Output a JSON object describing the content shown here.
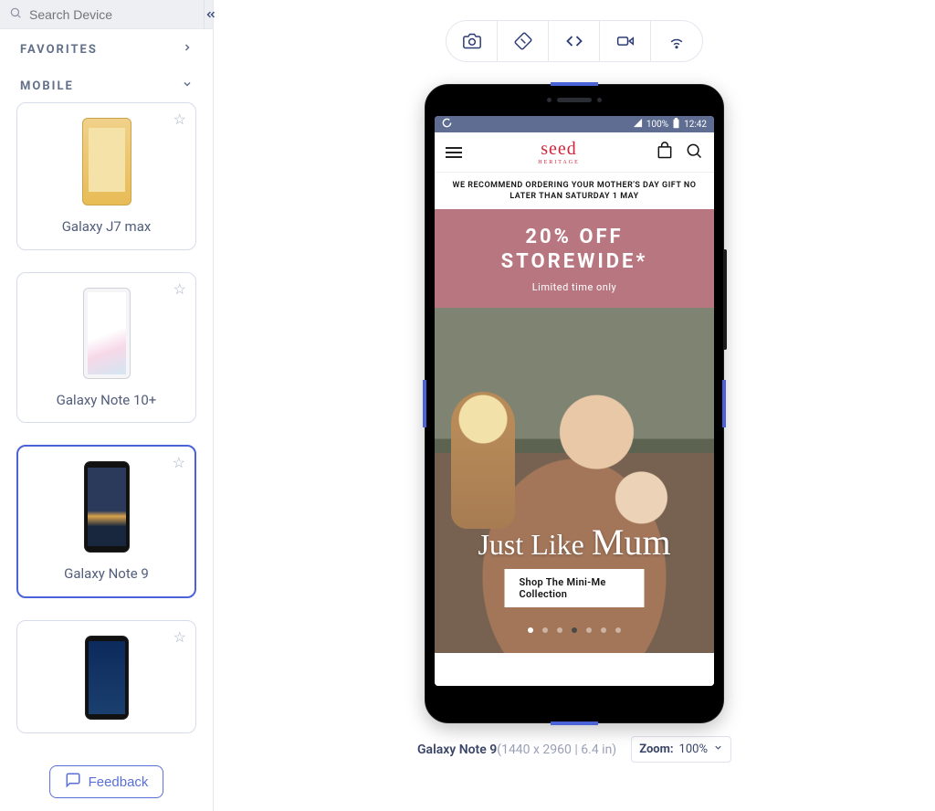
{
  "sidebar": {
    "search_placeholder": "Search Device",
    "sections": {
      "favorites": "FAVORITES",
      "mobile": "MOBILE"
    },
    "devices": [
      {
        "label": "Galaxy J7 max",
        "selected": false,
        "thumb": "thumb-gold"
      },
      {
        "label": "Galaxy Note 10+",
        "selected": false,
        "thumb": "thumb-white"
      },
      {
        "label": "Galaxy Note 9",
        "selected": true,
        "thumb": "thumb-note9"
      },
      {
        "label": "",
        "selected": false,
        "thumb": "thumb-s8"
      }
    ],
    "feedback": "Feedback"
  },
  "toolbar": {
    "items": [
      "camera",
      "rotate",
      "devtools",
      "record",
      "network"
    ]
  },
  "device_preview": {
    "status": {
      "battery": "100%",
      "time": "12:42"
    },
    "site": {
      "brand": "seed",
      "brand_sub": "HERITAGE",
      "notice": "WE RECOMMEND ORDERING YOUR MOTHER'S DAY GIFT NO LATER THAN SATURDAY 1 MAY",
      "promo_line1": "20% OFF",
      "promo_line2": "STOREWIDE*",
      "promo_sub": "Limited time only",
      "hero_script_a": "Just Like",
      "hero_script_b": "Mum",
      "cta": "Shop The Mini-Me Collection"
    }
  },
  "stage": {
    "device_name": "Galaxy Note 9",
    "dimensions": "(1440 x 2960 | 6.4 in)",
    "zoom_label": "Zoom:",
    "zoom_value": "100%"
  }
}
